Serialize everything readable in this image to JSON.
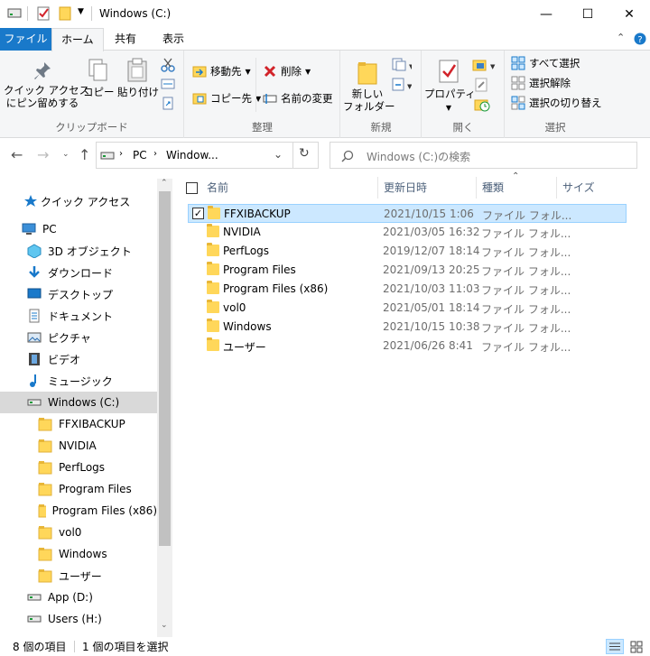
{
  "window": {
    "title": "Windows (C:)",
    "controls": {
      "minimize": "—",
      "maximize": "☐",
      "close": "✕"
    }
  },
  "menu": {
    "tabs": [
      "ファイル",
      "ホーム",
      "共有",
      "表示"
    ],
    "active_tab": "ホーム"
  },
  "ribbon": {
    "clipboard": {
      "label": "クリップボード",
      "pin_line1": "クイック アクセス",
      "pin_line2": "にピン留めする",
      "copy": "コピー",
      "paste": "貼り付け"
    },
    "organize": {
      "label": "整理",
      "move_to": "移動先",
      "copy_to": "コピー先",
      "delete": "削除",
      "rename": "名前の変更"
    },
    "new": {
      "label": "新規",
      "new_folder_line1": "新しい",
      "new_folder_line2": "フォルダー"
    },
    "open": {
      "label": "開く",
      "properties": "プロパティ"
    },
    "select": {
      "label": "選択",
      "select_all": "すべて選択",
      "select_none": "選択解除",
      "invert": "選択の切り替え"
    }
  },
  "address": {
    "crumb_pc": "PC",
    "crumb_drive": "Window...",
    "search_placeholder": "Windows (C:)の検索"
  },
  "sidebar": {
    "quick_access": "クイック アクセス",
    "items": [
      {
        "label": "PC",
        "icon": "pc-icon"
      },
      {
        "label": "3D オブジェクト",
        "icon": "3d-objects-icon"
      },
      {
        "label": "ダウンロード",
        "icon": "download-icon"
      },
      {
        "label": "デスクトップ",
        "icon": "desktop-icon"
      },
      {
        "label": "ドキュメント",
        "icon": "document-icon"
      },
      {
        "label": "ピクチャ",
        "icon": "picture-icon"
      },
      {
        "label": "ビデオ",
        "icon": "video-icon"
      },
      {
        "label": "ミュージック",
        "icon": "music-icon"
      },
      {
        "label": "Windows (C:)",
        "icon": "drive-icon"
      },
      {
        "label": "FFXIBACKUP",
        "icon": "folder-icon"
      },
      {
        "label": "NVIDIA",
        "icon": "folder-icon"
      },
      {
        "label": "PerfLogs",
        "icon": "folder-icon"
      },
      {
        "label": "Program Files",
        "icon": "folder-icon"
      },
      {
        "label": "Program Files (x86)",
        "icon": "folder-icon"
      },
      {
        "label": "vol0",
        "icon": "folder-icon"
      },
      {
        "label": "Windows",
        "icon": "folder-icon"
      },
      {
        "label": "ユーザー",
        "icon": "folder-icon"
      },
      {
        "label": "App (D:)",
        "icon": "drive-icon"
      },
      {
        "label": "Users (H:)",
        "icon": "drive-icon"
      }
    ]
  },
  "columns": {
    "name": "名前",
    "date": "更新日時",
    "type": "種類",
    "size": "サイズ"
  },
  "files": [
    {
      "name": "FFXIBACKUP",
      "date": "2021/10/15 1:06",
      "type": "ファイル フォル...",
      "selected": true
    },
    {
      "name": "NVIDIA",
      "date": "2021/03/05 16:32",
      "type": "ファイル フォル..."
    },
    {
      "name": "PerfLogs",
      "date": "2019/12/07 18:14",
      "type": "ファイル フォル..."
    },
    {
      "name": "Program Files",
      "date": "2021/09/13 20:25",
      "type": "ファイル フォル..."
    },
    {
      "name": "Program Files (x86)",
      "date": "2021/10/03 11:03",
      "type": "ファイル フォル..."
    },
    {
      "name": "vol0",
      "date": "2021/05/01 18:14",
      "type": "ファイル フォル..."
    },
    {
      "name": "Windows",
      "date": "2021/10/15 10:38",
      "type": "ファイル フォル..."
    },
    {
      "name": "ユーザー",
      "date": "2021/06/26 8:41",
      "type": "ファイル フォル..."
    }
  ],
  "status": {
    "item_count": "8 個の項目",
    "selected_count": "1 個の項目を選択"
  },
  "colors": {
    "accent": "#1979ca",
    "selection": "#cce8ff",
    "folder": "#ffd75a"
  }
}
